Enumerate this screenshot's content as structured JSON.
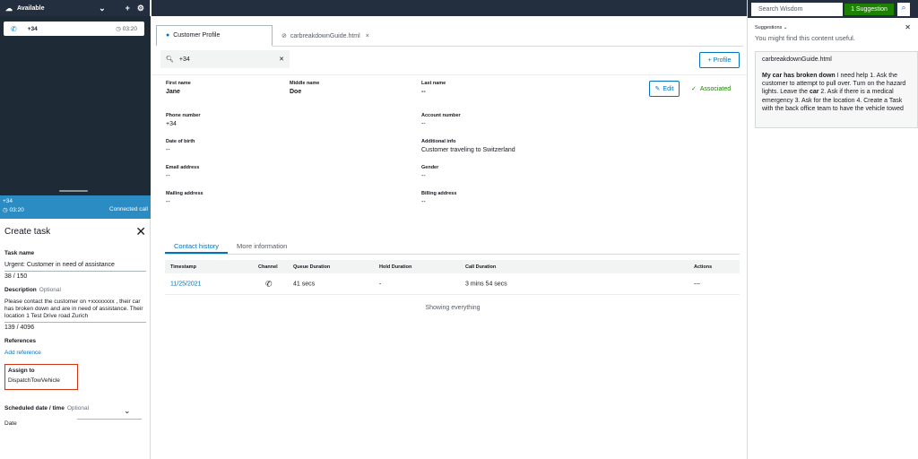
{
  "ccp": {
    "status": "Available",
    "contact": {
      "number": "+34",
      "time": "03:20"
    },
    "connected": {
      "number": "+34",
      "time": "03:20",
      "state": "Connected call"
    },
    "task": {
      "title": "Create task",
      "task_name_label": "Task name",
      "task_name_value": "Urgent: Customer in need of assistance",
      "task_name_count": "38 / 150",
      "description_label": "Description",
      "optional": "Optional",
      "description_value": "Please contact the customer on +xxxxxxxx , their car has broken down and are in need of assistance. Their location 1 Test Drive road Zurich",
      "description_count": "139 / 4096",
      "references_label": "References",
      "add_reference": "Add reference",
      "assign_label": "Assign to",
      "assign_value": "DispatchTowVehicle",
      "scheduled_label": "Scheduled date / time",
      "date_label": "Date"
    }
  },
  "tabs": [
    {
      "label": "Customer Profile"
    },
    {
      "label": "carbreakdownGuide.html"
    }
  ],
  "search": {
    "value": "+34"
  },
  "profile_button": "+ Profile",
  "edit_button": "Edit",
  "associated": "Associated",
  "fields": {
    "first_name": {
      "label": "First name",
      "value": "Jane"
    },
    "middle_name": {
      "label": "Middle name",
      "value": "Doe"
    },
    "last_name": {
      "label": "Last name",
      "value": "--"
    },
    "phone": {
      "label": "Phone number",
      "value": "+34"
    },
    "account": {
      "label": "Account number",
      "value": "--"
    },
    "dob": {
      "label": "Date of birth",
      "value": "--"
    },
    "additional": {
      "label": "Additional info",
      "value": "Customer traveling to Switzerland"
    },
    "email": {
      "label": "Email address",
      "value": "--"
    },
    "gender": {
      "label": "Gender",
      "value": "--"
    },
    "mailing": {
      "label": "Mailing address",
      "value": "--"
    },
    "billing": {
      "label": "Billing address",
      "value": "--"
    }
  },
  "history": {
    "tabs": [
      "Contact history",
      "More information"
    ],
    "columns": [
      "Timestamp",
      "Channel",
      "Queue Duration",
      "Hold Duration",
      "Call Duration",
      "Actions"
    ],
    "row": {
      "timestamp": "11/25/2021",
      "queue": "41 secs",
      "hold": "-",
      "call": "3 mins 54 secs",
      "actions": "---"
    },
    "footer": "Showing everything"
  },
  "wisdom": {
    "search_placeholder": "Search Wisdom",
    "suggestion_count": "1 Suggestion",
    "suggestions_label": "Suggestions",
    "help_text": "You might find this content useful.",
    "card_title": "carbreakdownGuide.html",
    "card_bold": "My car has broken down",
    "card_text_1": " I need help 1. Ask the customer to attempt to pull over. Turn on the hazard lights. Leave the ",
    "card_bold_2": "car",
    "card_text_2": " 2. Ask if there is a medical emergency 3. Ask for the location 4. Create a Task with the back office team to have the vehicle towed"
  }
}
